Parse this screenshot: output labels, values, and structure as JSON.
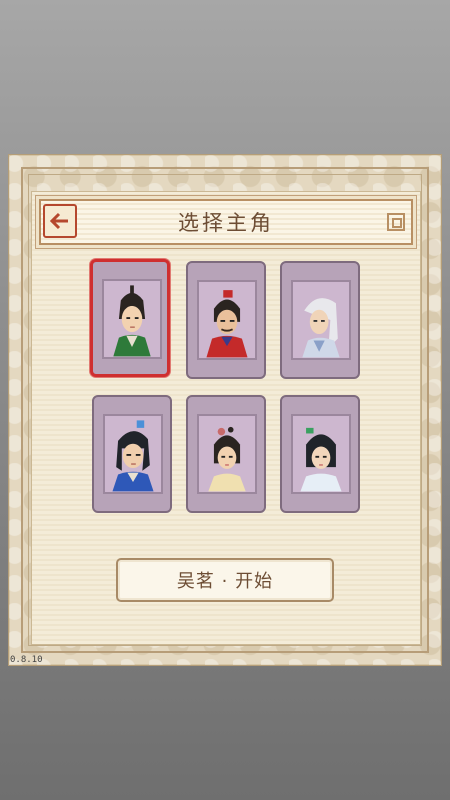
{
  "header": {
    "title": "选择主角",
    "back_icon": "arrow-left-icon",
    "back_glyph": "🡐"
  },
  "characters": [
    {
      "id": "char-1",
      "selected": true,
      "hair": "#2a2420",
      "skin": "#f2d2b0",
      "robe": "#2e7a3a",
      "accent": "#e8e0d0"
    },
    {
      "id": "char-2",
      "selected": false,
      "hair": "#2a2420",
      "skin": "#e9c09b",
      "robe": "#c42a2a",
      "accent": "#3a3a8a"
    },
    {
      "id": "char-3",
      "selected": false,
      "hair": "#e8e8ec",
      "skin": "#f0d4b8",
      "robe": "#cfd8e8",
      "accent": "#8aa0c8"
    },
    {
      "id": "char-4",
      "selected": false,
      "hair": "#20242a",
      "skin": "#f0cfad",
      "robe": "#2e58b8",
      "accent": "#4a90d8"
    },
    {
      "id": "char-5",
      "selected": false,
      "hair": "#2a2420",
      "skin": "#f2d2b0",
      "robe": "#f0e0b0",
      "accent": "#c86a6a"
    },
    {
      "id": "char-6",
      "selected": false,
      "hair": "#20242a",
      "skin": "#f2d6bc",
      "robe": "#e6eef6",
      "accent": "#3aa060"
    }
  ],
  "start_button": {
    "label": "吴茗 · 开始"
  },
  "version": "0.8.10",
  "colors": {
    "selected_border": "#cf2f2f",
    "card_bg": "#b7a3b8",
    "title_text": "#6d4d34"
  }
}
